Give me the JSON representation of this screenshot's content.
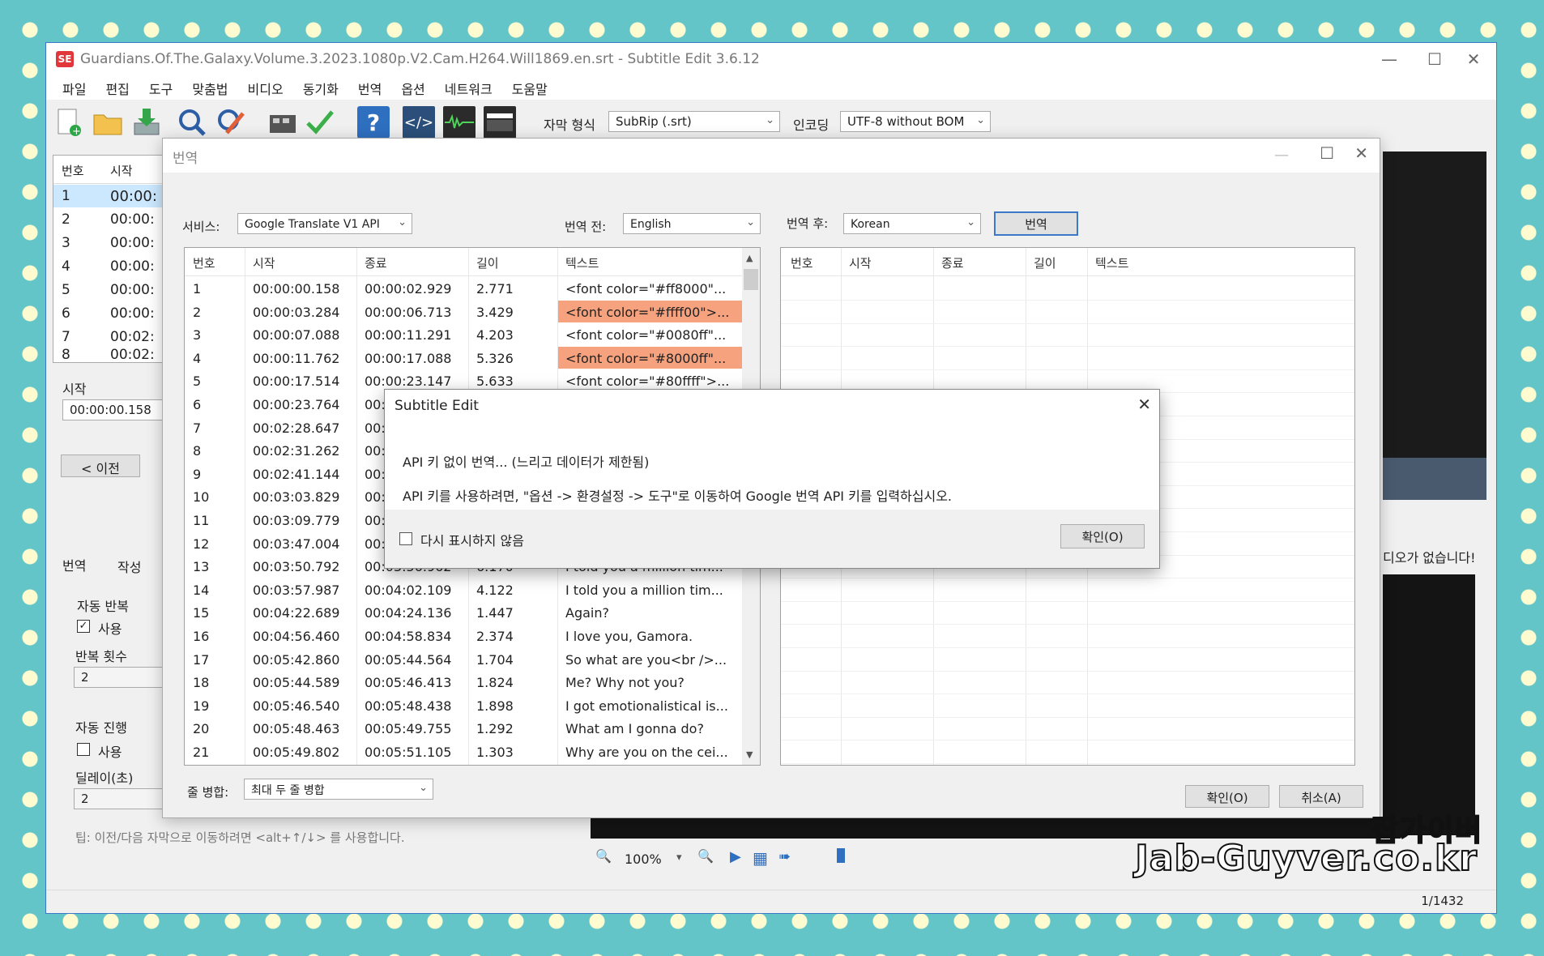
{
  "main": {
    "title": "Guardians.Of.The.Galaxy.Volume.3.2023.1080p.V2.Cam.H264.Will1869.en.srt - Subtitle Edit 3.6.12",
    "menu": [
      "파일",
      "편집",
      "도구",
      "맞춤법",
      "비디오",
      "동기화",
      "번역",
      "옵션",
      "네트워크",
      "도움말"
    ],
    "format_label": "자막 형식",
    "format_value": "SubRip (.srt)",
    "encoding_label": "인코딩",
    "encoding_value": "UTF-8 without BOM",
    "list_headers": {
      "no": "번호",
      "start": "시작"
    },
    "list_rows": [
      {
        "no": "1",
        "start": "00:00:"
      },
      {
        "no": "2",
        "start": "00:00:"
      },
      {
        "no": "3",
        "start": "00:00:"
      },
      {
        "no": "4",
        "start": "00:00:"
      },
      {
        "no": "5",
        "start": "00:00:"
      },
      {
        "no": "6",
        "start": "00:00:"
      },
      {
        "no": "7",
        "start": "00:02:"
      },
      {
        "no": "8",
        "start": "00:02:"
      }
    ],
    "start_label": "시작",
    "start_value": "00:00:00.158",
    "prev_button": "< 이전",
    "tabs": [
      "번역",
      "작성"
    ],
    "auto_repeat": "자동 반복",
    "use1": "사용",
    "repeat_count_label": "반복 횟수",
    "repeat_count": "2",
    "auto_continue": "자동 진행",
    "use2": "사용",
    "delay_label": "딜레이(초)",
    "delay": "2",
    "tip": "팁: 이전/다음 자막으로 이동하려면 <alt+↑/↓> 를 사용합니다.",
    "no_video": "디오가 없습니다!",
    "zoom": "100%",
    "status": "1/1432"
  },
  "translate": {
    "title": "번역",
    "service_label": "서비스:",
    "service_value": "Google Translate V1 API",
    "from_label": "번역 전:",
    "from_value": "English",
    "to_label": "번역 후:",
    "to_value": "Korean",
    "translate_button": "번역",
    "headers": {
      "no": "번호",
      "start": "시작",
      "end": "종료",
      "dur": "길이",
      "text": "텍스트"
    },
    "rows": [
      {
        "no": "1",
        "start": "00:00:00.158",
        "end": "00:00:02.929",
        "dur": "2.771",
        "text": "<font color=\"#ff8000\"..."
      },
      {
        "no": "2",
        "start": "00:00:03.284",
        "end": "00:00:06.713",
        "dur": "3.429",
        "text": "<font color=\"#ffff00\">..."
      },
      {
        "no": "3",
        "start": "00:00:07.088",
        "end": "00:00:11.291",
        "dur": "4.203",
        "text": "<font color=\"#0080ff\"..."
      },
      {
        "no": "4",
        "start": "00:00:11.762",
        "end": "00:00:17.088",
        "dur": "5.326",
        "text": "<font color=\"#8000ff\"..."
      },
      {
        "no": "5",
        "start": "00:00:17.514",
        "end": "00:00:23.147",
        "dur": "5.633",
        "text": "<font color=\"#80ffff\">..."
      },
      {
        "no": "6",
        "start": "00:00:23.764",
        "end": "00:",
        "dur": "",
        "text": ""
      },
      {
        "no": "7",
        "start": "00:02:28.647",
        "end": "00:",
        "dur": "",
        "text": ""
      },
      {
        "no": "8",
        "start": "00:02:31.262",
        "end": "00:",
        "dur": "",
        "text": ""
      },
      {
        "no": "9",
        "start": "00:02:41.144",
        "end": "00:",
        "dur": "",
        "text": ""
      },
      {
        "no": "10",
        "start": "00:03:03.829",
        "end": "00:",
        "dur": "",
        "text": ""
      },
      {
        "no": "11",
        "start": "00:03:09.779",
        "end": "00:",
        "dur": "",
        "text": ""
      },
      {
        "no": "12",
        "start": "00:03:47.004",
        "end": "00:",
        "dur": "",
        "text": ""
      },
      {
        "no": "13",
        "start": "00:03:50.792",
        "end": "00:03:56.962",
        "dur": "6.170",
        "text": "I told you a million tim..."
      },
      {
        "no": "14",
        "start": "00:03:57.987",
        "end": "00:04:02.109",
        "dur": "4.122",
        "text": "I told you a million tim..."
      },
      {
        "no": "15",
        "start": "00:04:22.689",
        "end": "00:04:24.136",
        "dur": "1.447",
        "text": "Again?"
      },
      {
        "no": "16",
        "start": "00:04:56.460",
        "end": "00:04:58.834",
        "dur": "2.374",
        "text": "I love you, Gamora."
      },
      {
        "no": "17",
        "start": "00:05:42.860",
        "end": "00:05:44.564",
        "dur": "1.704",
        "text": "So what are you<br />..."
      },
      {
        "no": "18",
        "start": "00:05:44.589",
        "end": "00:05:46.413",
        "dur": "1.824",
        "text": "Me? Why not you?"
      },
      {
        "no": "19",
        "start": "00:05:46.540",
        "end": "00:05:48.438",
        "dur": "1.898",
        "text": "I got emotionalistical is..."
      },
      {
        "no": "20",
        "start": "00:05:48.463",
        "end": "00:05:49.755",
        "dur": "1.292",
        "text": "What am I gonna do?"
      },
      {
        "no": "21",
        "start": "00:05:49.802",
        "end": "00:05:51.105",
        "dur": "1.303",
        "text": "Why are you on the cei..."
      }
    ],
    "merge_label": "줄 병합:",
    "merge_value": "최대 두 줄 병합",
    "ok_button": "확인(O)",
    "cancel_button": "취소(A)"
  },
  "msgbox": {
    "title": "Subtitle Edit",
    "line1": "API 키 없이 번역... (느리고 데이터가 제한됨)",
    "line2": "API 키를 사용하려면, \"옵션 -> 환경설정 -> 도구\"로 이동하여 Google 번역 API 키를 입력하십시오.",
    "checkbox_label": "다시 표시하지 않음",
    "ok_button": "확인(O)"
  },
  "watermark": {
    "line1": "잡가이버",
    "line2": "Jab-Guyver.co.kr"
  },
  "colors": {
    "highlight": "#f7a27e",
    "selected_row": "#cce8ff",
    "accent": "#3b78c8"
  }
}
